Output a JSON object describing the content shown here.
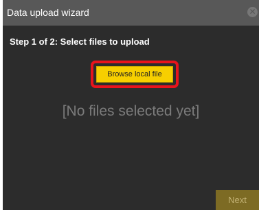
{
  "dialog": {
    "title": "Data upload wizard",
    "close_icon": "close-circle-icon",
    "step_label": "Step 1 of 2: Select files to upload",
    "browse_label": "Browse local file",
    "status_text": "[No files selected yet]",
    "next_label": "Next"
  },
  "colors": {
    "titlebar": "#585858",
    "body": "#2c2c2c",
    "browse_button": "#f7cf00",
    "highlight": "#e8141c",
    "next_button_disabled": "#7d6b24"
  }
}
